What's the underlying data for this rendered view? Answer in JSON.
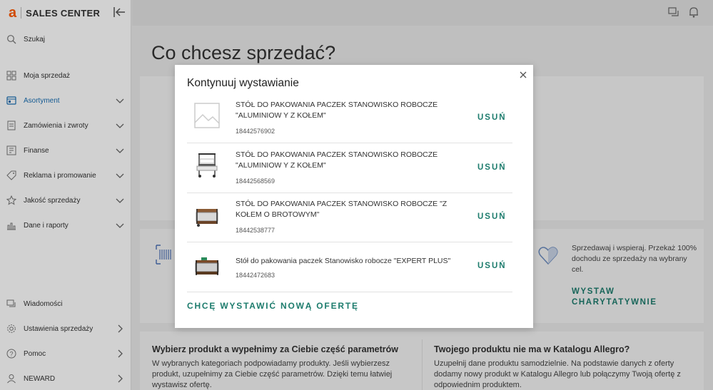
{
  "logo": {
    "mark": "a",
    "text": "SALES CENTER",
    "brand_color": "#ff5a00"
  },
  "sidebar": {
    "search_label": "Szukaj",
    "items": [
      {
        "label": "Moja sprzedaż",
        "icon": "grid-icon"
      },
      {
        "label": "Asortyment",
        "icon": "inventory-icon",
        "active": true
      },
      {
        "label": "Zamówienia i zwroty",
        "icon": "orders-icon"
      },
      {
        "label": "Finanse",
        "icon": "finance-icon"
      },
      {
        "label": "Reklama i promowanie",
        "icon": "tag-icon"
      },
      {
        "label": "Jakość sprzedaży",
        "icon": "star-icon"
      },
      {
        "label": "Dane i raporty",
        "icon": "chart-icon"
      }
    ],
    "bottom_items": [
      {
        "label": "Wiadomości",
        "icon": "messages-icon"
      },
      {
        "label": "Ustawienia sprzedaży",
        "icon": "settings-icon"
      },
      {
        "label": "Pomoc",
        "icon": "help-icon"
      },
      {
        "label": "NEWARD",
        "icon": "user-icon"
      }
    ]
  },
  "main": {
    "title": "Co chcesz sprzedać?",
    "charity": {
      "text": "Sprzedawaj i wspieraj. Przekaż 100% dochodu ze sprzedaży na wybrany cel.",
      "button": "WYSTAW CHARYTATYWNIE"
    },
    "info_left": {
      "title": "Wybierz produkt a wypełnimy za Ciebie część parametrów",
      "text": "W wybranych kategoriach podpowiadamy produkty. Jeśli wybierzesz produkt, uzupełnimy za Ciebie część parametrów. Dzięki temu łatwiej wystawisz ofertę."
    },
    "info_right": {
      "title": "Twojego produktu nie ma w Katalogu Allegro?",
      "text": "Uzupełnij dane produktu samodzielnie. Na podstawie danych z oferty dodamy nowy produkt w Katalogu Allegro lub połączymy Twoją ofertę z odpowiednim produktem."
    }
  },
  "modal": {
    "title": "Kontynuuj wystawianie",
    "delete_label": "USUŃ",
    "new_offer_label": "CHCĘ WYSTAWIĆ NOWĄ OFERTĘ",
    "accent_color": "#1d7c6d",
    "offers": [
      {
        "title": "STÓŁ DO PAKOWANIA PACZEK STANOWISKO ROBOCZE \"ALUMINIOW Y Z KOŁEM\"",
        "id": "18442576902"
      },
      {
        "title": "STÓŁ DO PAKOWANIA PACZEK STANOWISKO ROBOCZE \"ALUMINIOW Y Z KOŁEM\"",
        "id": "18442568569"
      },
      {
        "title": "STÓŁ DO PAKOWANIA PACZEK STANOWISKO ROBOCZE \"Z KOŁEM O BROTOWYM\"",
        "id": "18442538777"
      },
      {
        "title": "Stół do pakowania paczek Stanowisko robocze \"EXPERT PLUS\"",
        "id": "18442472683"
      }
    ]
  }
}
